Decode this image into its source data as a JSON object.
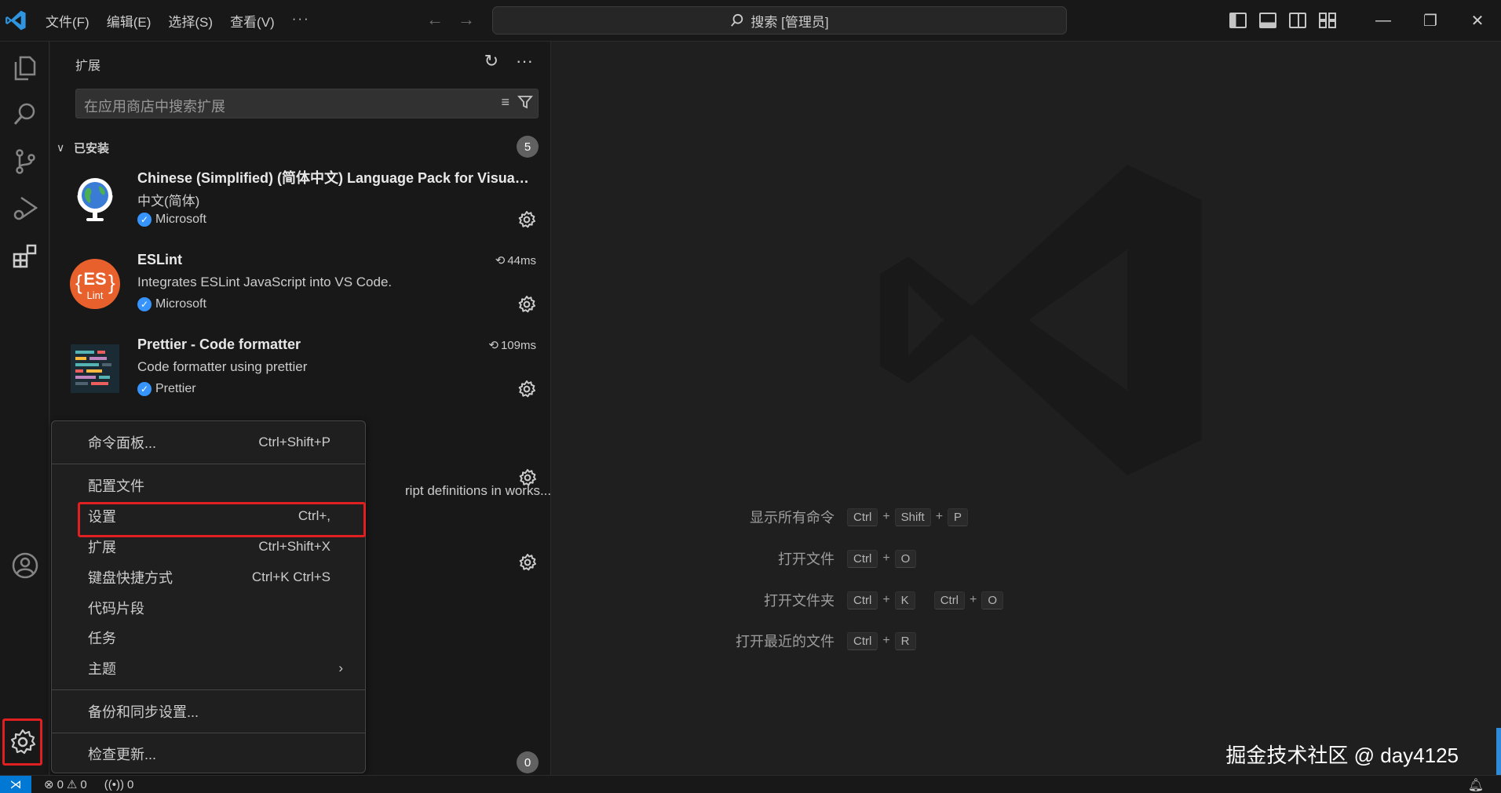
{
  "menubar": {
    "file": "文件(F)",
    "edit": "编辑(E)",
    "selection": "选择(S)",
    "view": "查看(V)",
    "more": "···"
  },
  "command_center": {
    "text": "搜索 [管理员]"
  },
  "sidebar": {
    "title": "扩展",
    "search_placeholder": "在应用商店中搜索扩展",
    "installed_label": "已安装",
    "installed_count": "5",
    "bottom_count": "0",
    "extensions": [
      {
        "name": "Chinese (Simplified) (简体中文) Language Pack for Visual Studio Code",
        "description": "中文(简体)",
        "publisher": "Microsoft",
        "time": "",
        "icon": "globe-icon"
      },
      {
        "name": "ESLint",
        "description": "Integrates ESLint JavaScript into VS Code.",
        "publisher": "Microsoft",
        "time": "44ms",
        "icon": "eslint-icon"
      },
      {
        "name": "Prettier - Code formatter",
        "description": "Code formatter using prettier",
        "publisher": "Prettier",
        "time": "109ms",
        "icon": "prettier-icon"
      }
    ],
    "partial_desc": "ript definitions in works..."
  },
  "context_menu": {
    "items": [
      {
        "label": "命令面板...",
        "shortcut": "Ctrl+Shift+P"
      },
      {
        "label": "配置文件",
        "shortcut": ""
      },
      {
        "label": "设置",
        "shortcut": "Ctrl+,"
      },
      {
        "label": "扩展",
        "shortcut": "Ctrl+Shift+X"
      },
      {
        "label": "键盘快捷方式",
        "shortcut": "Ctrl+K Ctrl+S"
      },
      {
        "label": "代码片段",
        "shortcut": ""
      },
      {
        "label": "任务",
        "shortcut": ""
      },
      {
        "label": "主题",
        "shortcut": ""
      },
      {
        "label": "备份和同步设置...",
        "shortcut": ""
      },
      {
        "label": "检查更新...",
        "shortcut": ""
      }
    ]
  },
  "editor_hints": {
    "show_commands": {
      "label": "显示所有命令",
      "keys": [
        "Ctrl",
        "Shift",
        "P"
      ]
    },
    "open_file": {
      "label": "打开文件",
      "keys": [
        "Ctrl",
        "O"
      ]
    },
    "open_folder": {
      "label": "打开文件夹",
      "keys1": [
        "Ctrl",
        "K"
      ],
      "keys2": [
        "Ctrl",
        "O"
      ]
    },
    "open_recent": {
      "label": "打开最近的文件",
      "keys": [
        "Ctrl",
        "R"
      ]
    }
  },
  "watermark": "掘金技术社区 @ day4125",
  "statusbar": {
    "errors": "0",
    "warnings": "0",
    "ports": "0"
  },
  "colors": {
    "accent": "#0078d4",
    "highlight_box": "#e02020",
    "badge": "#616161"
  }
}
